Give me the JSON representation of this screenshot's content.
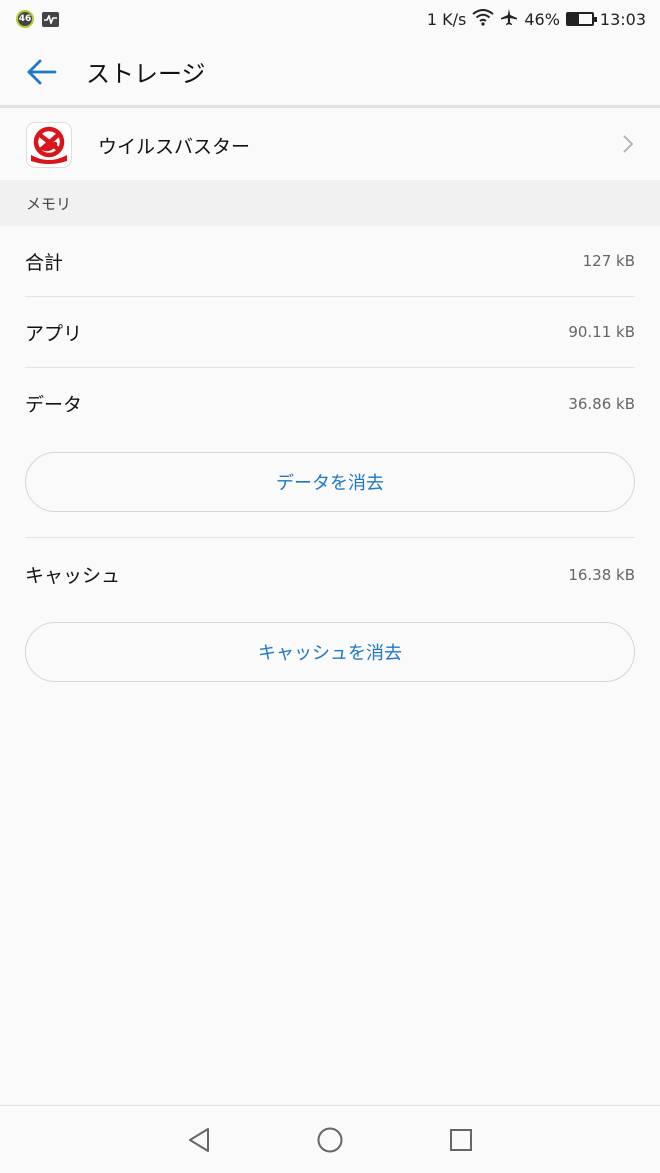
{
  "status_bar": {
    "badge": "46",
    "speed": "1 K/s",
    "battery": "46%",
    "battery_level": 0.46,
    "time": "13:03"
  },
  "app_bar": {
    "title": "ストレージ"
  },
  "app": {
    "name": "ウイルスバスター"
  },
  "memory": {
    "header": "メモリ",
    "rows": [
      {
        "label": "合計",
        "value": "127 kB"
      },
      {
        "label": "アプリ",
        "value": "90.11 kB"
      },
      {
        "label": "データ",
        "value": "36.86 kB"
      }
    ],
    "clear_data_label": "データを消去",
    "cache": {
      "label": "キャッシュ",
      "value": "16.38 kB"
    },
    "clear_cache_label": "キャッシュを消去"
  },
  "colors": {
    "accent": "#1e78c8",
    "app_icon_red": "#d9141b"
  },
  "icons": {
    "back": "arrow-left-icon",
    "chevron": "chevron-right-icon",
    "nav_back": "triangle-back-icon",
    "nav_home": "circle-home-icon",
    "nav_recents": "square-recents-icon"
  }
}
